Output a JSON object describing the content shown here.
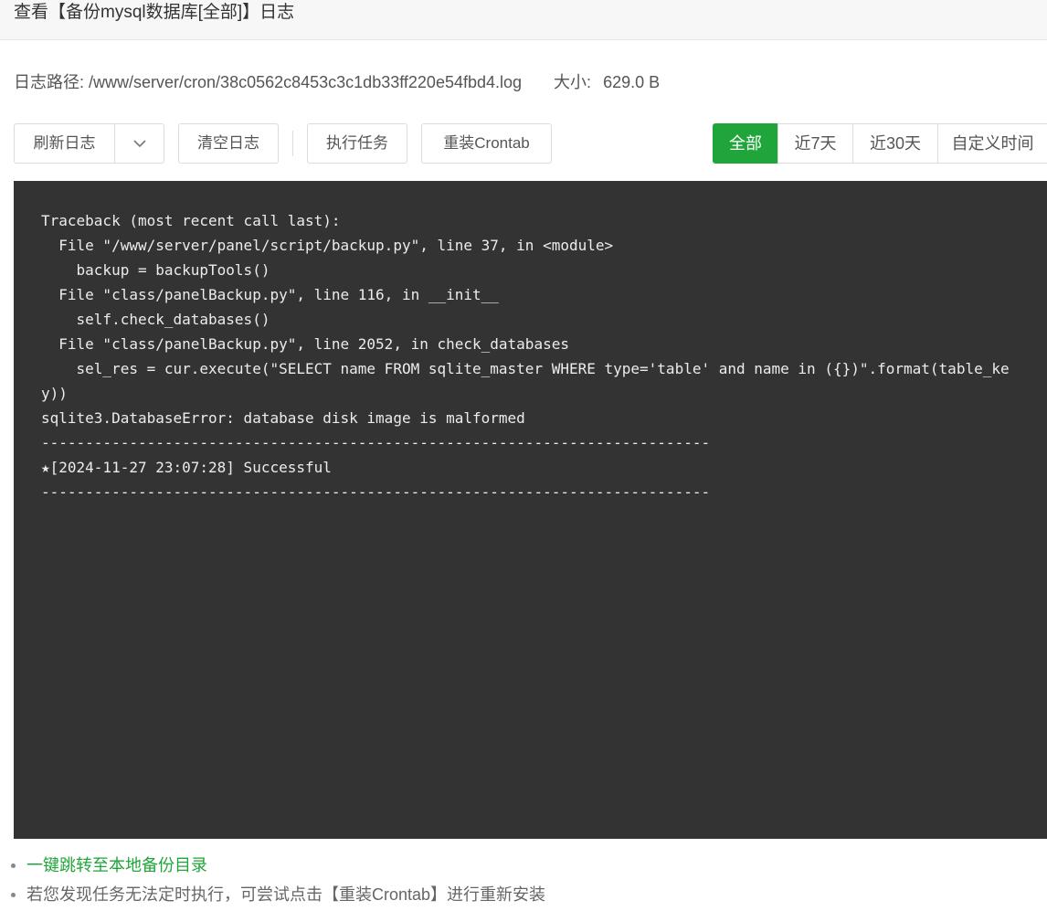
{
  "window": {
    "title": "查看【备份mysql数据库[全部]】日志"
  },
  "info": {
    "path_label": "日志路径:",
    "path_value": "/www/server/cron/38c0562c8453c3c1db33ff220e54fbd4.log",
    "size_label": "大小:",
    "size_value": "629.0 B"
  },
  "toolbar": {
    "refresh_label": "刷新日志",
    "refresh_caret_icon": "chevron-down-icon",
    "clear_label": "清空日志",
    "exec_label": "执行任务",
    "reinstall_label": "重装Crontab"
  },
  "filters": {
    "active": "全部",
    "tabs": [
      "全部",
      "近7天",
      "近30天",
      "自定义时间"
    ]
  },
  "log": {
    "content": "Traceback (most recent call last):\n  File \"/www/server/panel/script/backup.py\", line 37, in <module>\n    backup = backupTools()\n  File \"class/panelBackup.py\", line 116, in __init__\n    self.check_databases()\n  File \"class/panelBackup.py\", line 2052, in check_databases\n    sel_res = cur.execute(\"SELECT name FROM sqlite_master WHERE type='table' and name in ({})\".format(table_key))\nsqlite3.DatabaseError: database disk image is malformed\n----------------------------------------------------------------------------\n★[2024-11-27 23:07:28] Successful\n----------------------------------------------------------------------------"
  },
  "tips": {
    "link": "一键跳转至本地备份目录",
    "note": "若您发现任务无法定时执行，可尝试点击【重装Crontab】进行重新安装"
  },
  "colors": {
    "accent": "#20a53a",
    "log_background": "#333333",
    "log_text": "#ececec"
  }
}
